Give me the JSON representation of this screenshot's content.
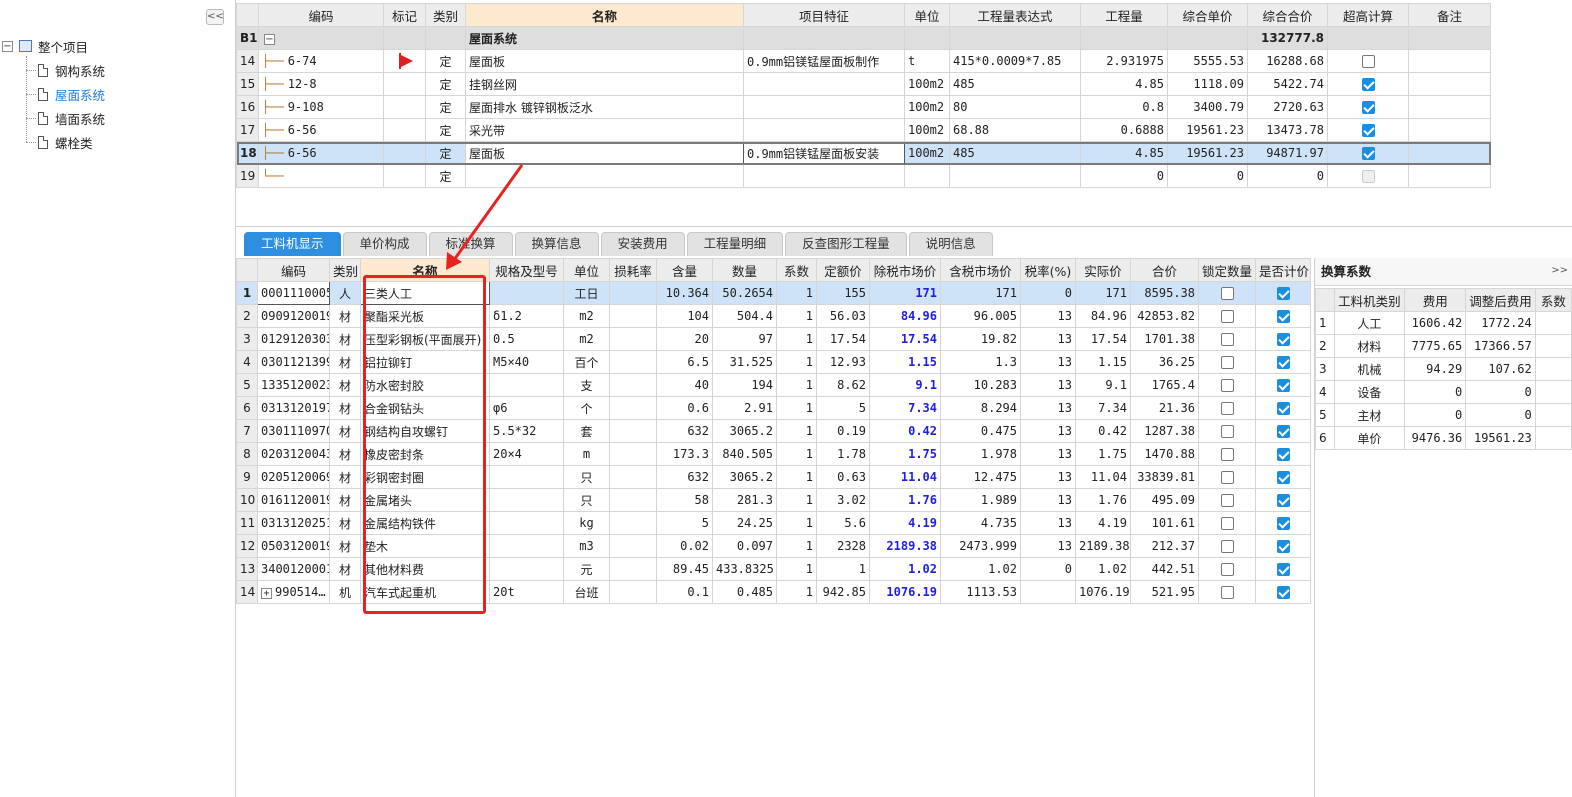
{
  "sidebar": {
    "collapse_label": "<<",
    "root": {
      "label": "整个项目",
      "expander": "−"
    },
    "items": [
      {
        "label": "钢构系统",
        "selected": false
      },
      {
        "label": "屋面系统",
        "selected": true
      },
      {
        "label": "墙面系统",
        "selected": false
      },
      {
        "label": "螺栓类",
        "selected": false
      }
    ]
  },
  "top_grid": {
    "headers": [
      "编码",
      "标记",
      "类别",
      "名称",
      "项目特征",
      "单位",
      "工程量表达式",
      "工程量",
      "综合单价",
      "综合合价",
      "超高计算",
      "备注"
    ],
    "group": {
      "row": "B1",
      "expander": "−",
      "name": "屋面系统",
      "total": "132777.8"
    },
    "rows": [
      {
        "row": "14",
        "code": "6-74",
        "flag": true,
        "type": "定",
        "name": "屋面板",
        "feature": "0.9mm铝镁锰屋面板制作",
        "unit": "t",
        "expr": "415*0.0009*7.85",
        "qty": "2.931975",
        "price": "5555.53",
        "total": "16288.68",
        "check": "off"
      },
      {
        "row": "15",
        "code": "12-8",
        "flag": false,
        "type": "定",
        "name": "挂钢丝网",
        "feature": "",
        "unit": "100m2",
        "expr": "485",
        "qty": "4.85",
        "price": "1118.09",
        "total": "5422.74",
        "check": "on"
      },
      {
        "row": "16",
        "code": "9-108",
        "flag": false,
        "type": "定",
        "name": "屋面排水 镀锌钢板泛水",
        "feature": "",
        "unit": "100m2",
        "expr": "80",
        "qty": "0.8",
        "price": "3400.79",
        "total": "2720.63",
        "check": "on"
      },
      {
        "row": "17",
        "code": "6-56",
        "flag": false,
        "type": "定",
        "name": "采光带",
        "feature": "",
        "unit": "100m2",
        "expr": "68.88",
        "qty": "0.6888",
        "price": "19561.23",
        "total": "13473.78",
        "check": "on"
      },
      {
        "row": "18",
        "code": "6-56",
        "flag": false,
        "type": "定",
        "name": "屋面板",
        "feature": "0.9mm铝镁锰屋面板安装",
        "unit": "100m2",
        "expr": "485",
        "qty": "4.85",
        "price": "19561.23",
        "total": "94871.97",
        "check": "on",
        "selected": true
      },
      {
        "row": "19",
        "code": "",
        "flag": false,
        "type": "定",
        "name": "",
        "feature": "",
        "unit": "",
        "expr": "",
        "qty": "0",
        "price": "0",
        "total": "0",
        "check": "dis"
      }
    ]
  },
  "tabs": [
    "工料机显示",
    "单价构成",
    "标准换算",
    "换算信息",
    "安装费用",
    "工程量明细",
    "反查图形工程量",
    "说明信息"
  ],
  "bottom_grid": {
    "headers": [
      "编码",
      "类别",
      "名称",
      "规格及型号",
      "单位",
      "损耗率",
      "含量",
      "数量",
      "系数",
      "定额价",
      "除税市场价",
      "含税市场价",
      "税率(%)",
      "实际价",
      "合价",
      "锁定数量",
      "是否计价"
    ],
    "rows": [
      {
        "row": "1",
        "code": "0001110005",
        "type": "人",
        "name": "三类人工",
        "spec": "",
        "unit": "工日",
        "loss": "",
        "content": "10.364",
        "qty": "50.2654",
        "coef": "1",
        "base": "155",
        "ex_tax": "171",
        "in_tax": "171",
        "tax": "0",
        "actual": "171",
        "total": "8595.38",
        "selected": true
      },
      {
        "row": "2",
        "code": "0909120019",
        "type": "材",
        "name": "聚酯采光板",
        "spec": "δ1.2",
        "unit": "m2",
        "loss": "",
        "content": "104",
        "qty": "504.4",
        "coef": "1",
        "base": "56.03",
        "ex_tax": "84.96",
        "in_tax": "96.005",
        "tax": "13",
        "actual": "84.96",
        "total": "42853.82"
      },
      {
        "row": "3",
        "code": "0129120303",
        "type": "材",
        "name": "压型彩钢板(平面展开)",
        "spec": "0.5",
        "unit": "m2",
        "loss": "",
        "content": "20",
        "qty": "97",
        "coef": "1",
        "base": "17.54",
        "ex_tax": "17.54",
        "in_tax": "19.82",
        "tax": "13",
        "actual": "17.54",
        "total": "1701.38"
      },
      {
        "row": "4",
        "code": "0301121399",
        "type": "材",
        "name": "铝拉铆钉",
        "spec": "M5×40",
        "unit": "百个",
        "loss": "",
        "content": "6.5",
        "qty": "31.525",
        "coef": "1",
        "base": "12.93",
        "ex_tax": "1.15",
        "in_tax": "1.3",
        "tax": "13",
        "actual": "1.15",
        "total": "36.25"
      },
      {
        "row": "5",
        "code": "1335120023",
        "type": "材",
        "name": "防水密封胶",
        "spec": "",
        "unit": "支",
        "loss": "",
        "content": "40",
        "qty": "194",
        "coef": "1",
        "base": "8.62",
        "ex_tax": "9.1",
        "in_tax": "10.283",
        "tax": "13",
        "actual": "9.1",
        "total": "1765.4"
      },
      {
        "row": "6",
        "code": "0313120197",
        "type": "材",
        "name": "合金钢钻头",
        "spec": "φ6",
        "unit": "个",
        "loss": "",
        "content": "0.6",
        "qty": "2.91",
        "coef": "1",
        "base": "5",
        "ex_tax": "7.34",
        "in_tax": "8.294",
        "tax": "13",
        "actual": "7.34",
        "total": "21.36"
      },
      {
        "row": "7",
        "code": "0301110970",
        "type": "材",
        "name": "钢结构自攻螺钉",
        "spec": "5.5*32",
        "unit": "套",
        "loss": "",
        "content": "632",
        "qty": "3065.2",
        "coef": "1",
        "base": "0.19",
        "ex_tax": "0.42",
        "in_tax": "0.475",
        "tax": "13",
        "actual": "0.42",
        "total": "1287.38"
      },
      {
        "row": "8",
        "code": "0203120043",
        "type": "材",
        "name": "橡皮密封条",
        "spec": "20×4",
        "unit": "m",
        "loss": "",
        "content": "173.3",
        "qty": "840.505",
        "coef": "1",
        "base": "1.78",
        "ex_tax": "1.75",
        "in_tax": "1.978",
        "tax": "13",
        "actual": "1.75",
        "total": "1470.88"
      },
      {
        "row": "9",
        "code": "0205120069",
        "type": "材",
        "name": "彩钢密封圈",
        "spec": "",
        "unit": "只",
        "loss": "",
        "content": "632",
        "qty": "3065.2",
        "coef": "1",
        "base": "0.63",
        "ex_tax": "11.04",
        "in_tax": "12.475",
        "tax": "13",
        "actual": "11.04",
        "total": "33839.81"
      },
      {
        "row": "10",
        "code": "0161120019",
        "type": "材",
        "name": "金属堵头",
        "spec": "",
        "unit": "只",
        "loss": "",
        "content": "58",
        "qty": "281.3",
        "coef": "1",
        "base": "3.02",
        "ex_tax": "1.76",
        "in_tax": "1.989",
        "tax": "13",
        "actual": "1.76",
        "total": "495.09"
      },
      {
        "row": "11",
        "code": "0313120251",
        "type": "材",
        "name": "金属结构铁件",
        "spec": "",
        "unit": "kg",
        "loss": "",
        "content": "5",
        "qty": "24.25",
        "coef": "1",
        "base": "5.6",
        "ex_tax": "4.19",
        "in_tax": "4.735",
        "tax": "13",
        "actual": "4.19",
        "total": "101.61"
      },
      {
        "row": "12",
        "code": "0503120019",
        "type": "材",
        "name": "垫木",
        "spec": "",
        "unit": "m3",
        "loss": "",
        "content": "0.02",
        "qty": "0.097",
        "coef": "1",
        "base": "2328",
        "ex_tax": "2189.38",
        "in_tax": "2473.999",
        "tax": "13",
        "actual": "2189.38",
        "total": "212.37"
      },
      {
        "row": "13",
        "code": "3400120001",
        "type": "材",
        "name": "其他材料费",
        "spec": "",
        "unit": "元",
        "loss": "",
        "content": "89.45",
        "qty": "433.8325",
        "coef": "1",
        "base": "1",
        "ex_tax": "1.02",
        "in_tax": "1.02",
        "tax": "0",
        "actual": "1.02",
        "total": "442.51"
      },
      {
        "row": "14",
        "code": "990514…",
        "type": "机",
        "name": "汽车式起重机",
        "spec": "20t",
        "unit": "台班",
        "loss": "",
        "content": "0.1",
        "qty": "0.485",
        "coef": "1",
        "base": "942.85",
        "ex_tax": "1076.19",
        "in_tax": "1113.53",
        "tax": "",
        "actual": "1076.19",
        "total": "521.95",
        "expander": "+"
      }
    ]
  },
  "side_panel": {
    "title": "换算系数",
    "close": ">>",
    "headers": [
      "工料机类别",
      "费用",
      "调整后费用",
      "系数"
    ],
    "rows": [
      {
        "row": "1",
        "category": "人工",
        "fee": "1606.42",
        "adjusted": "1772.24"
      },
      {
        "row": "2",
        "category": "材料",
        "fee": "7775.65",
        "adjusted": "17366.57"
      },
      {
        "row": "3",
        "category": "机械",
        "fee": "94.29",
        "adjusted": "107.62"
      },
      {
        "row": "4",
        "category": "设备",
        "fee": "0",
        "adjusted": "0"
      },
      {
        "row": "5",
        "category": "主材",
        "fee": "0",
        "adjusted": "0"
      },
      {
        "row": "6",
        "category": "单价",
        "fee": "9476.36",
        "adjusted": "19561.23"
      }
    ]
  },
  "colors": {
    "accent": "#2e8fe0",
    "highlight_box": "#e8231f",
    "selected_row": "#cfe3f8",
    "name_header": "#fde9cf"
  }
}
